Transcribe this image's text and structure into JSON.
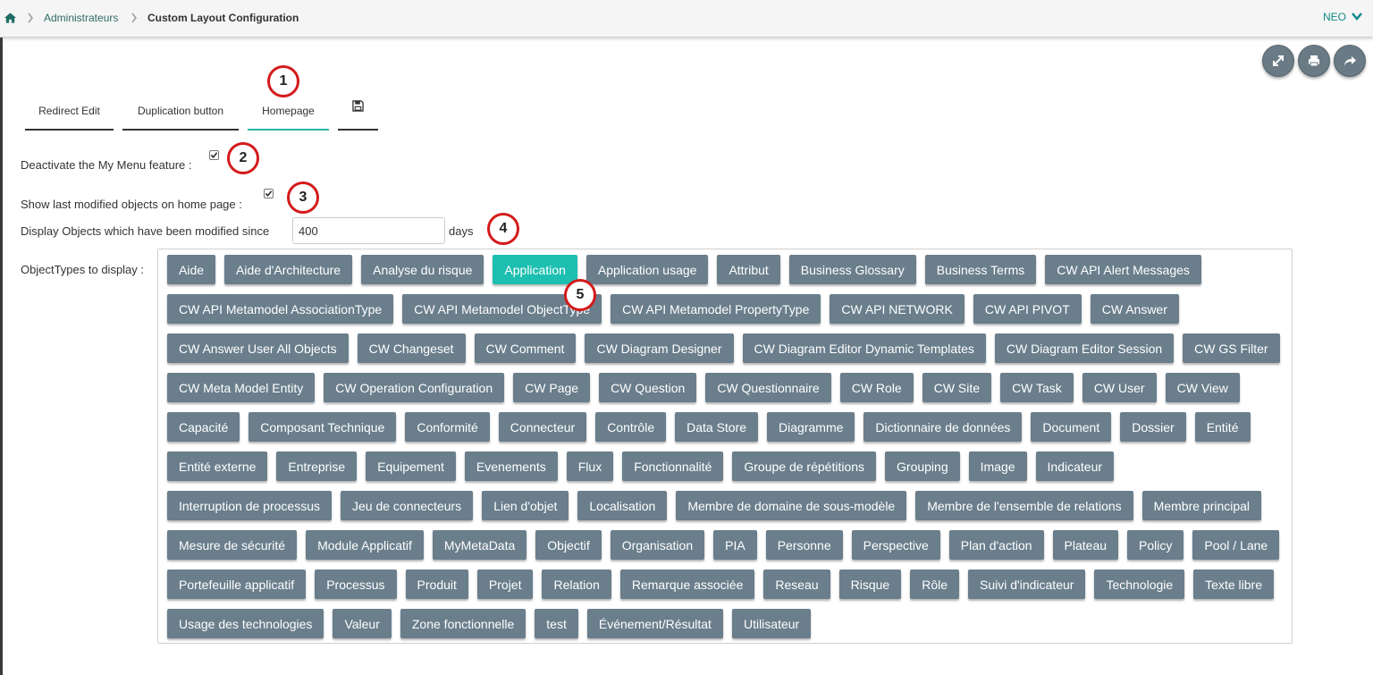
{
  "breadcrumb": {
    "link": "Administrateurs",
    "current": "Custom Layout Configuration"
  },
  "user": {
    "name": "NEO"
  },
  "tabs": [
    {
      "label": "Redirect Edit"
    },
    {
      "label": "Duplication button"
    },
    {
      "label": "Homepage",
      "active": true
    },
    {
      "label": "",
      "icon": "save-icon"
    }
  ],
  "callouts": [
    "1",
    "2",
    "3",
    "4",
    "5"
  ],
  "settings": {
    "deactivate_my_menu_label": "Deactivate the My Menu feature :",
    "deactivate_my_menu_checked": true,
    "show_last_modified_label": "Show last modified objects on home page :",
    "show_last_modified_checked": true,
    "display_since_label": "Display Objects which have been modified since",
    "display_since_value": "400",
    "days_label": "days",
    "object_types_label": "ObjectTypes to display :"
  },
  "object_types": [
    [
      "Aide",
      "Aide d'Architecture",
      "Analyse du risque",
      "Application",
      "Application usage",
      "Attribut",
      "Business Glossary",
      "Business Terms",
      "CW API Alert Messages"
    ],
    [
      "CW API Metamodel AssociationType",
      "CW API Metamodel ObjectType",
      "CW API Metamodel PropertyType",
      "CW API NETWORK",
      "CW API PIVOT",
      "CW Answer"
    ],
    [
      "CW Answer User All Objects",
      "CW Changeset",
      "CW Comment",
      "CW Diagram Designer",
      "CW Diagram Editor Dynamic Templates",
      "CW Diagram Editor Session",
      "CW GS Filter"
    ],
    [
      "CW Meta Model Entity",
      "CW Operation Configuration",
      "CW Page",
      "CW Question",
      "CW Questionnaire",
      "CW Role",
      "CW Site",
      "CW Task",
      "CW User",
      "CW View"
    ],
    [
      "Capacité",
      "Composant Technique",
      "Conformité",
      "Connecteur",
      "Contrôle",
      "Data Store",
      "Diagramme",
      "Dictionnaire de données",
      "Document",
      "Dossier",
      "Entité"
    ],
    [
      "Entité externe",
      "Entreprise",
      "Equipement",
      "Evenements",
      "Flux",
      "Fonctionnalité",
      "Groupe de répétitions",
      "Grouping",
      "Image",
      "Indicateur"
    ],
    [
      "Interruption de processus",
      "Jeu de connecteurs",
      "Lien d'objet",
      "Localisation",
      "Membre de domaine de sous-modèle",
      "Membre de l'ensemble de relations",
      "Membre principal"
    ],
    [
      "Mesure de sécurité",
      "Module Applicatif",
      "MyMetaData",
      "Objectif",
      "Organisation",
      "PIA",
      "Personne",
      "Perspective",
      "Plan d'action",
      "Plateau",
      "Policy",
      "Pool / Lane"
    ],
    [
      "Portefeuille applicatif",
      "Processus",
      "Produit",
      "Projet",
      "Relation",
      "Remarque associée",
      "Reseau",
      "Risque",
      "Rôle",
      "Suivi d'indicateur",
      "Technologie",
      "Texte libre"
    ],
    [
      "Usage des technologies",
      "Valeur",
      "Zone fonctionnelle",
      "test",
      "Événement/Résultat",
      "Utilisateur"
    ]
  ],
  "selected_type": "Application",
  "colors": {
    "type_button": "#6a7e8c",
    "type_button_selected": "#1dbfb0",
    "active_tab_underline": "#2ab7a9",
    "callout_border": "#d41a1a",
    "link": "#2e6b68"
  }
}
